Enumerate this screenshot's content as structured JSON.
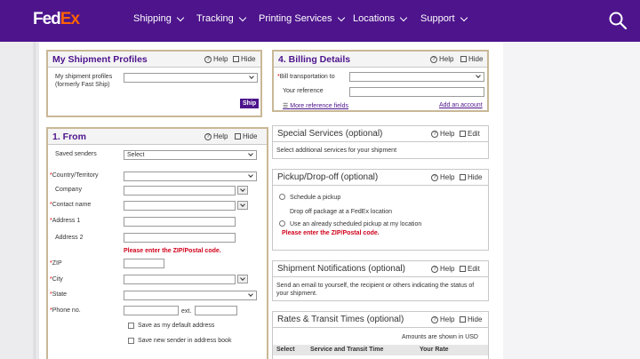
{
  "brand": {
    "fed": "Fed",
    "ex": "Ex"
  },
  "nav": {
    "items": [
      "Shipping",
      "Tracking",
      "Printing Services",
      "Locations",
      "Support"
    ]
  },
  "common": {
    "help": "Help",
    "hide": "Hide",
    "edit": "Edit"
  },
  "profiles": {
    "title": "My Shipment Profiles",
    "label": "My shipment profiles (formerly Fast Ship)",
    "ship_button": "Ship"
  },
  "billing": {
    "title": "4. Billing Details",
    "bill_to": "Bill transportation to",
    "your_reference": "Your reference",
    "more_reference": "More reference fields",
    "add_account": "Add an account"
  },
  "from": {
    "title": "1. From",
    "saved_senders": "Saved senders",
    "select": "Select",
    "country": "Country/Territory",
    "company": "Company",
    "contact": "Contact name",
    "address1": "Address 1",
    "address2": "Address 2",
    "zip_error": "Please enter the ZIP/Postal code.",
    "zip": "ZIP",
    "city": "City",
    "state": "State",
    "phone": "Phone no.",
    "ext": "ext.",
    "save_default": "Save as my default address",
    "save_new": "Save new sender in address book"
  },
  "special": {
    "title": "Special Services (optional)",
    "desc": "Select additional services for your shipment"
  },
  "pickup": {
    "title": "Pickup/Drop-off (optional)",
    "opt1": "Schedule a pickup",
    "opt2": "Drop off package at a FedEx location",
    "opt3": "Use an already scheduled pickup at my location",
    "error": "Please enter the ZIP/Postal code."
  },
  "notifications": {
    "title": "Shipment Notifications (optional)",
    "desc": "Send an email to yourself, the recipient or others indicating the status of your shipment."
  },
  "rates": {
    "title": "Rates & Transit Times (optional)",
    "amounts": "Amounts are shown in USD",
    "col_select": "Select",
    "col_service": "Service and Transit Time",
    "col_rate": "Your Rate"
  },
  "colors": {
    "purple": "#4d148c",
    "orange": "#ff6200",
    "error": "#d0021b"
  }
}
